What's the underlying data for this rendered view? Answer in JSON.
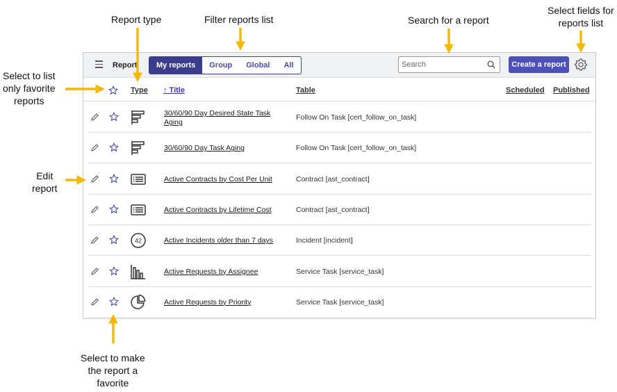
{
  "annotations": {
    "report_type": "Report type",
    "filter_reports": "Filter reports list",
    "search_report": "Search for a report",
    "select_fields_1": "Select fields for",
    "select_fields_2": "reports list",
    "favorites_1": "Select to list",
    "favorites_2": "only favorite",
    "favorites_3": "reports",
    "edit_1": "Edit",
    "edit_2": "report",
    "make_fav_1": "Select to make",
    "make_fav_2": "the report a",
    "make_fav_3": "favorite"
  },
  "toolbar": {
    "title": "Report",
    "tabs": [
      "My reports",
      "Group",
      "Global",
      "All"
    ],
    "active_tab": "My reports",
    "search_placeholder": "Search",
    "create_label": "Create a report",
    "accent_color": "#4d50b5"
  },
  "columns": {
    "type": "Type",
    "title": "↑ Title",
    "table": "Table",
    "scheduled": "Scheduled",
    "published": "Published"
  },
  "rows": [
    {
      "title_1": "30/60/90 Day Desired State Task",
      "title_2": "Aging",
      "table": "Follow On Task [cert_follow_on_task]",
      "type_icon": "horizontal-bar-chart-icon"
    },
    {
      "title_1": "30/60/90 Day Task Aging",
      "title_2": "",
      "table": "Follow On Task [cert_follow_on_task]",
      "type_icon": "horizontal-bar-chart-icon"
    },
    {
      "title_1": "Active Contracts by Cost Per Unit",
      "title_2": "",
      "table": "Contract [ast_contract]",
      "type_icon": "list-report-icon"
    },
    {
      "title_1": "Active Contracts by Lifetime Cost",
      "title_2": "",
      "table": "Contract [ast_contract]",
      "type_icon": "list-report-icon"
    },
    {
      "title_1": "Active Incidents older than 7 days",
      "title_2": "",
      "table": "Incident [incident]",
      "type_icon": "single-score-icon",
      "score_label": "42"
    },
    {
      "title_1": "Active Requests by Assignee",
      "title_2": "",
      "table": "Service Task [service_task]",
      "type_icon": "vertical-bar-chart-icon"
    },
    {
      "title_1": "Active Requests by Priority",
      "title_2": "",
      "table": "Service Task [service_task]",
      "type_icon": "pie-chart-icon"
    }
  ]
}
